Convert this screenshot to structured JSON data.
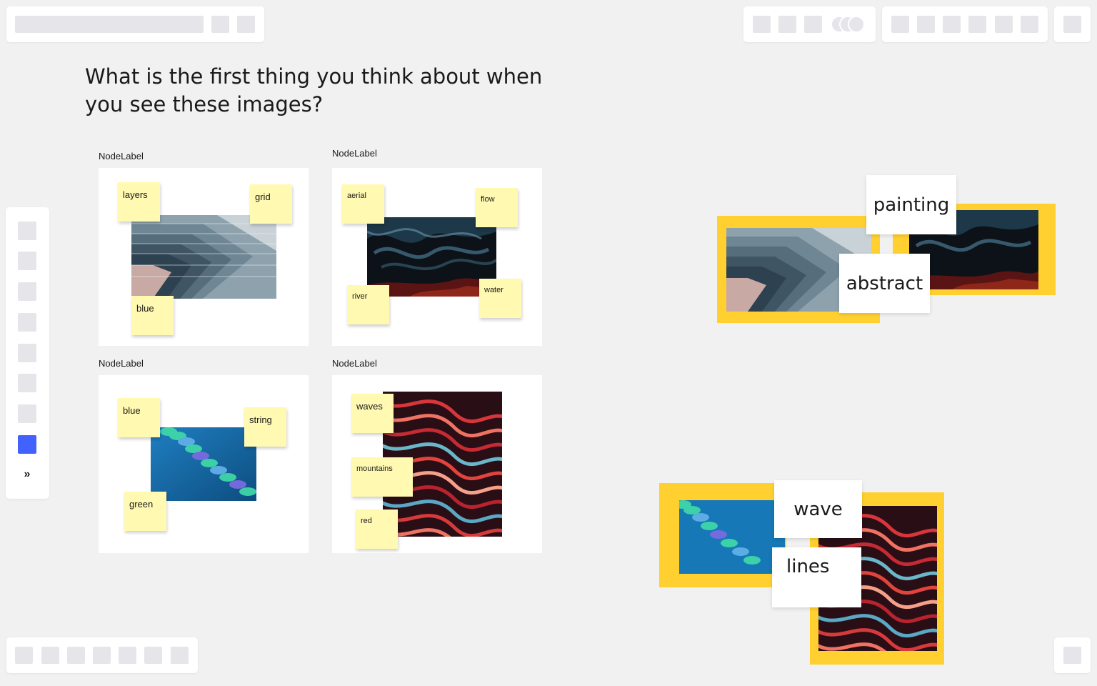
{
  "question": "What is the first thing you think about when you see these images?",
  "frames": [
    {
      "label": "NodeLabel",
      "image": "layers-image",
      "stickies": [
        "layers",
        "grid",
        "blue"
      ]
    },
    {
      "label": "NodeLabel",
      "image": "smoke-image",
      "stickies": [
        "aerial",
        "flow",
        "river",
        "water"
      ]
    },
    {
      "label": "NodeLabel",
      "image": "spiral-image",
      "stickies": [
        "blue",
        "string",
        "green"
      ]
    },
    {
      "label": "NodeLabel",
      "image": "waves-image",
      "stickies": [
        "waves",
        "mountains",
        "red"
      ]
    }
  ],
  "word_cards": [
    "painting",
    "abstract",
    "wave",
    "lines"
  ],
  "toolbar": {
    "expand_icon": "»"
  },
  "colors": {
    "sticky": "#fff9b1",
    "accent_yellow": "#ffd02f",
    "active_tool": "#4262ff"
  }
}
